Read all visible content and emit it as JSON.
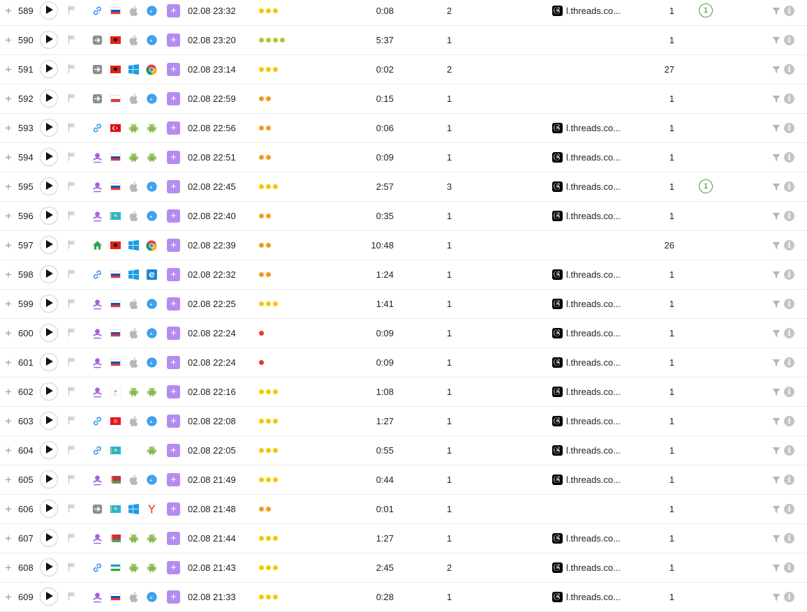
{
  "colors": {
    "accent": "#b48cf0",
    "yellow": "#f5c800",
    "orange": "#f39a1b",
    "green": "#a7c93a",
    "red": "#e8392a",
    "goal": "#3aa33a"
  },
  "icons": {
    "expand": "+",
    "add": "+",
    "info": "i"
  },
  "rows": [
    {
      "n": "589",
      "src": "link-icon",
      "flag": "ru",
      "os": "apple",
      "browser": "safari",
      "date": "02.08 23:32",
      "dots": {
        "count": 3,
        "color": "yellow"
      },
      "dur": "0:08",
      "views": "2",
      "ref": "l.threads.co...",
      "visits": "1",
      "goal": "1"
    },
    {
      "n": "590",
      "src": "direct-icon",
      "flag": "al",
      "os": "apple",
      "browser": "safari",
      "date": "02.08 23:20",
      "dots": {
        "count": 4,
        "color": "green"
      },
      "dur": "5:37",
      "views": "1",
      "ref": "",
      "visits": "1",
      "goal": ""
    },
    {
      "n": "591",
      "src": "direct-icon",
      "flag": "al",
      "os": "windows",
      "browser": "chrome",
      "date": "02.08 23:14",
      "dots": {
        "count": 3,
        "color": "yellow"
      },
      "dur": "0:02",
      "views": "2",
      "ref": "",
      "visits": "27",
      "goal": ""
    },
    {
      "n": "592",
      "src": "direct-icon",
      "flag": "pl",
      "os": "apple",
      "browser": "safari",
      "date": "02.08 22:59",
      "dots": {
        "count": 2,
        "color": "orange"
      },
      "dur": "0:15",
      "views": "1",
      "ref": "",
      "visits": "1",
      "goal": ""
    },
    {
      "n": "593",
      "src": "link-icon",
      "flag": "tr",
      "os": "android",
      "browser": "android",
      "date": "02.08 22:56",
      "dots": {
        "count": 2,
        "color": "orange"
      },
      "dur": "0:06",
      "views": "1",
      "ref": "l.threads.co...",
      "visits": "1",
      "goal": ""
    },
    {
      "n": "594",
      "src": "social-icon",
      "flag": "ru",
      "os": "android",
      "browser": "android",
      "date": "02.08 22:51",
      "dots": {
        "count": 2,
        "color": "orange"
      },
      "dur": "0:09",
      "views": "1",
      "ref": "l.threads.co...",
      "visits": "1",
      "goal": ""
    },
    {
      "n": "595",
      "src": "social-icon",
      "flag": "ru",
      "os": "apple",
      "browser": "safari",
      "date": "02.08 22:45",
      "dots": {
        "count": 3,
        "color": "yellow"
      },
      "dur": "2:57",
      "views": "3",
      "ref": "l.threads.co...",
      "visits": "1",
      "goal": "1"
    },
    {
      "n": "596",
      "src": "social-icon",
      "flag": "kz",
      "os": "apple",
      "browser": "safari",
      "date": "02.08 22:40",
      "dots": {
        "count": 2,
        "color": "orange"
      },
      "dur": "0:35",
      "views": "1",
      "ref": "l.threads.co...",
      "visits": "1",
      "goal": ""
    },
    {
      "n": "597",
      "src": "home-icon",
      "flag": "al",
      "os": "windows",
      "browser": "chrome",
      "date": "02.08 22:39",
      "dots": {
        "count": 2,
        "color": "orange"
      },
      "dur": "10:48",
      "views": "1",
      "ref": "",
      "visits": "26",
      "goal": ""
    },
    {
      "n": "598",
      "src": "link-icon",
      "flag": "ru",
      "os": "windows",
      "browser": "edge",
      "date": "02.08 22:32",
      "dots": {
        "count": 2,
        "color": "orange"
      },
      "dur": "1:24",
      "views": "1",
      "ref": "l.threads.co...",
      "visits": "1",
      "goal": ""
    },
    {
      "n": "599",
      "src": "social-icon",
      "flag": "ru",
      "os": "apple",
      "browser": "safari",
      "date": "02.08 22:25",
      "dots": {
        "count": 3,
        "color": "yellow"
      },
      "dur": "1:41",
      "views": "1",
      "ref": "l.threads.co...",
      "visits": "1",
      "goal": ""
    },
    {
      "n": "600",
      "src": "social-icon",
      "flag": "ru",
      "os": "apple",
      "browser": "safari",
      "date": "02.08 22:24",
      "dots": {
        "count": 1,
        "color": "red"
      },
      "dur": "0:09",
      "views": "1",
      "ref": "l.threads.co...",
      "visits": "1",
      "goal": ""
    },
    {
      "n": "601",
      "src": "social-icon",
      "flag": "ru",
      "os": "apple",
      "browser": "safari",
      "date": "02.08 22:24",
      "dots": {
        "count": 1,
        "color": "red"
      },
      "dur": "0:09",
      "views": "1",
      "ref": "l.threads.co...",
      "visits": "1",
      "goal": ""
    },
    {
      "n": "602",
      "src": "social-icon",
      "flag": "cy",
      "os": "android",
      "browser": "android",
      "date": "02.08 22:16",
      "dots": {
        "count": 3,
        "color": "yellow"
      },
      "dur": "1:08",
      "views": "1",
      "ref": "l.threads.co...",
      "visits": "1",
      "goal": ""
    },
    {
      "n": "603",
      "src": "link-icon",
      "flag": "kg",
      "os": "apple",
      "browser": "safari",
      "date": "02.08 22:08",
      "dots": {
        "count": 3,
        "color": "yellow"
      },
      "dur": "1:27",
      "views": "1",
      "ref": "l.threads.co...",
      "visits": "1",
      "goal": ""
    },
    {
      "n": "604",
      "src": "link-icon",
      "flag": "kz",
      "os": "",
      "browser": "android",
      "date": "02.08 22:05",
      "dots": {
        "count": 3,
        "color": "yellow"
      },
      "dur": "0:55",
      "views": "1",
      "ref": "l.threads.co...",
      "visits": "1",
      "goal": ""
    },
    {
      "n": "605",
      "src": "social-icon",
      "flag": "by",
      "os": "apple",
      "browser": "safari",
      "date": "02.08 21:49",
      "dots": {
        "count": 3,
        "color": "yellow"
      },
      "dur": "0:44",
      "views": "1",
      "ref": "l.threads.co...",
      "visits": "1",
      "goal": ""
    },
    {
      "n": "606",
      "src": "direct-icon",
      "flag": "kz",
      "os": "windows",
      "browser": "yandex",
      "date": "02.08 21:48",
      "dots": {
        "count": 2,
        "color": "orange"
      },
      "dur": "0:01",
      "views": "1",
      "ref": "",
      "visits": "1",
      "goal": ""
    },
    {
      "n": "607",
      "src": "social-icon",
      "flag": "by",
      "os": "android",
      "browser": "android",
      "date": "02.08 21:44",
      "dots": {
        "count": 3,
        "color": "yellow"
      },
      "dur": "1:27",
      "views": "1",
      "ref": "l.threads.co...",
      "visits": "1",
      "goal": ""
    },
    {
      "n": "608",
      "src": "link-icon",
      "flag": "uz",
      "os": "android",
      "browser": "android",
      "date": "02.08 21:43",
      "dots": {
        "count": 3,
        "color": "yellow"
      },
      "dur": "2:45",
      "views": "2",
      "ref": "l.threads.co...",
      "visits": "1",
      "goal": ""
    },
    {
      "n": "609",
      "src": "social-icon",
      "flag": "ru",
      "os": "apple",
      "browser": "safari",
      "date": "02.08 21:33",
      "dots": {
        "count": 3,
        "color": "yellow"
      },
      "dur": "0:28",
      "views": "1",
      "ref": "l.threads.co...",
      "visits": "1",
      "goal": ""
    }
  ]
}
